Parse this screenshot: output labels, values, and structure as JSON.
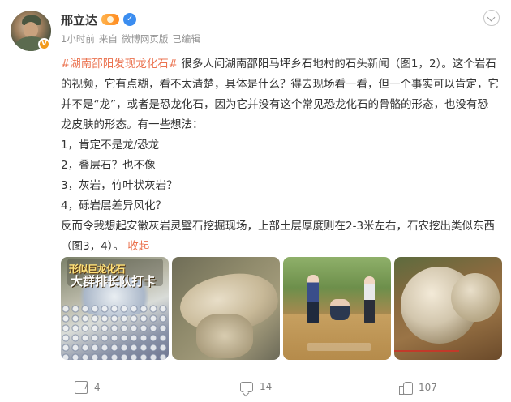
{
  "author": {
    "name": "邢立达"
  },
  "meta": {
    "time": "1小时前",
    "from_label": "来自",
    "source": "微博网页版",
    "edited": "已编辑"
  },
  "post": {
    "hashtag": "#湖南邵阳发现龙化石#",
    "intro": " 很多人问湖南邵阳马坪乡石地村的石头新闻（图1，2）。这个岩石的视频，它有点糊，看不太清楚，具体是什么？得去现场看一看，但一个事实可以肯定，它并不是“龙”，或者是恐龙化石，因为它并没有这个常见恐龙化石的骨骼的形态，也没有恐龙皮肤的形态。有一些想法：",
    "list": [
      "1，肯定不是龙/恐龙",
      "2，叠层石？也不像",
      "3，灰岩，竹叶状灰岩？",
      "4，砾岩层差异风化？"
    ],
    "closing": "反而令我想起安徽灰岩灵璧石挖掘现场，上部土层厚度则在2-3米左右，石农挖出类似东西（图3，4）。",
    "collapse": "收起"
  },
  "images": [
    {
      "caption_top": "形似巨龙化石",
      "caption_main": "大群排长队打卡"
    },
    {},
    {},
    {}
  ],
  "actions": {
    "share_count": "4",
    "comment_count": "14",
    "like_count": "107"
  },
  "colors": {
    "accent": "#eb7350",
    "text": "#333333",
    "muted": "#939393"
  }
}
